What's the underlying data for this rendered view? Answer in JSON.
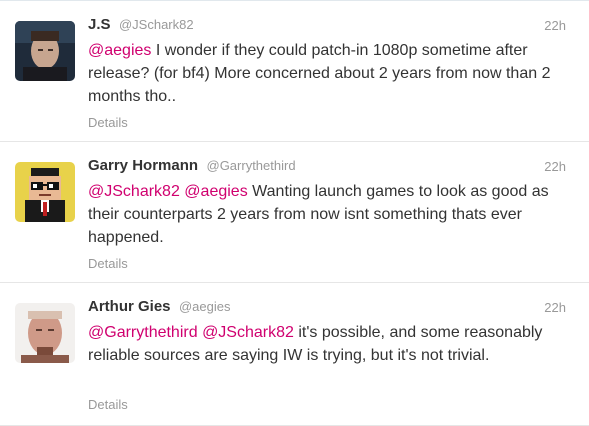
{
  "tweets": [
    {
      "fullname": "J.S",
      "username": "@JSchark82",
      "time": "22h",
      "mentions": [
        "@aegies"
      ],
      "text": " I wonder if they could patch-in 1080p sometime after release? (for bf4) More concerned about 2 years from now than 2 months tho..",
      "details_label": "Details"
    },
    {
      "fullname": "Garry Hormann",
      "username": "@Garrythethird",
      "time": "22h",
      "mentions": [
        "@JSchark82",
        "@aegies"
      ],
      "text": " Wanting launch games to look as good as their counterparts 2 years from now isnt something thats ever happened.",
      "details_label": "Details"
    },
    {
      "fullname": "Arthur Gies",
      "username": "@aegies",
      "time": "22h",
      "mentions": [
        "@Garrythethird",
        "@JSchark82"
      ],
      "text": " it's possible, and some reasonably reliable sources are saying IW is trying, but it's not trivial.",
      "details_label": "Details"
    }
  ],
  "colors": {
    "mention": "#d0006f",
    "muted": "#999999",
    "text": "#333333"
  }
}
